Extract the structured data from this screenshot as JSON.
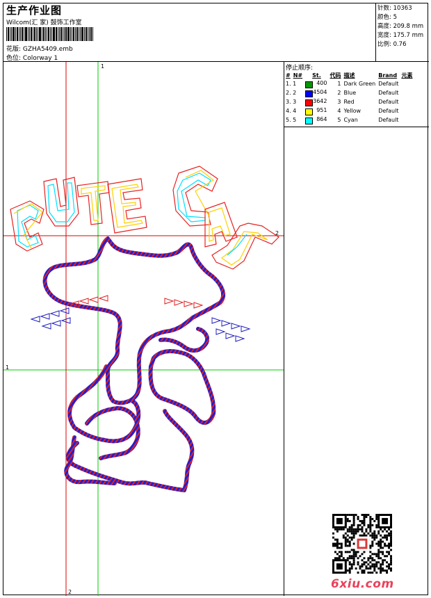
{
  "header": {
    "title": "生产作业图",
    "studio": "Wilcom(汇 家) 鼓饰工作室",
    "design_label": "花版:",
    "design_value": "GZHA5409.emb",
    "colorway_label": "色位:",
    "colorway_value": "Colorway 1"
  },
  "stats": {
    "stitches": "针数: 10363",
    "colors": "颜色: 5",
    "height": "高度: 209.8 mm",
    "width": "宽度: 175.7 mm",
    "scale": "比例: 0.76"
  },
  "stop_sequence": {
    "heading": "停止顺序:",
    "columns": [
      "#",
      "N#",
      "St.",
      "代码",
      "描述",
      "Brand",
      "元素"
    ],
    "rows": [
      {
        "idx": "1. 1",
        "color": "#009900",
        "st": "400",
        "code": "1",
        "desc": "Dark Green",
        "brand": "Default"
      },
      {
        "idx": "2. 2",
        "color": "#0000ff",
        "st": "4504",
        "code": "2",
        "desc": "Blue",
        "brand": "Default"
      },
      {
        "idx": "3. 3",
        "color": "#ff0000",
        "st": "3642",
        "code": "3",
        "desc": "Red",
        "brand": "Default"
      },
      {
        "idx": "4. 4",
        "color": "#ffff00",
        "st": "951",
        "code": "4",
        "desc": "Yellow",
        "brand": "Default"
      },
      {
        "idx": "5. 5",
        "color": "#00ffff",
        "st": "864",
        "code": "5",
        "desc": "Cyan",
        "brand": "Default"
      }
    ]
  },
  "axes": {
    "v_green": "1",
    "h_red": "2",
    "h_green": "1",
    "v_red": "2"
  },
  "watermark": "6xiu.com"
}
